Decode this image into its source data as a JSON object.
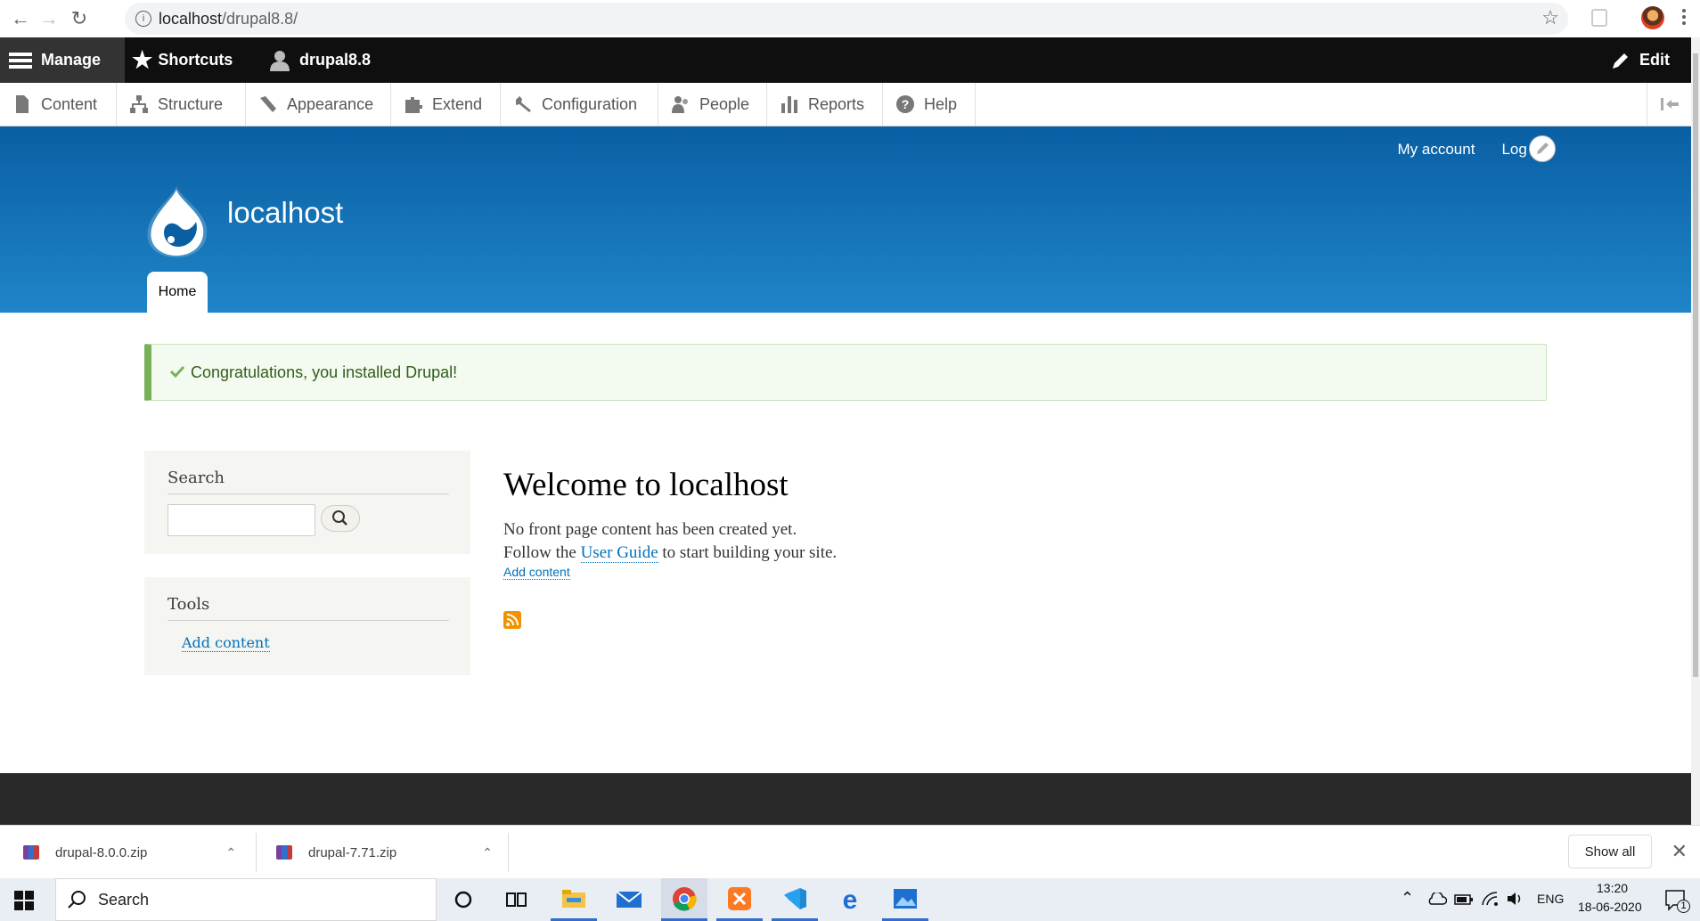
{
  "browser": {
    "url_host": "localhost",
    "url_path": "/drupal8.8/"
  },
  "toolbar": {
    "manage": "Manage",
    "shortcuts": "Shortcuts",
    "user": "drupal8.8",
    "edit": "Edit"
  },
  "tray": {
    "items": [
      {
        "label": "Content",
        "icon": "file-icon"
      },
      {
        "label": "Structure",
        "icon": "sitemap-icon"
      },
      {
        "label": "Appearance",
        "icon": "brush-icon"
      },
      {
        "label": "Extend",
        "icon": "puzzle-icon"
      },
      {
        "label": "Configuration",
        "icon": "wrench-icon"
      },
      {
        "label": "People",
        "icon": "people-icon"
      },
      {
        "label": "Reports",
        "icon": "bar-chart-icon"
      },
      {
        "label": "Help",
        "icon": "help-icon"
      }
    ]
  },
  "header": {
    "my_account": "My account",
    "log_out": "Log o",
    "site_name": "localhost",
    "home_tab": "Home"
  },
  "status": {
    "message": "Congratulations, you installed Drupal!",
    "color": "#77b259"
  },
  "sidebar": {
    "search_title": "Search",
    "tools_title": "Tools",
    "tools_link": "Add content"
  },
  "main": {
    "title": "Welcome to localhost",
    "line1": "No front page content has been created yet.",
    "line2_prefix": "Follow the ",
    "line2_link": "User Guide",
    "line2_suffix": " to start building your site.",
    "add_content": "Add content"
  },
  "downloads": {
    "file1": "drupal-8.0.0.zip",
    "file2": "drupal-7.71.zip",
    "show_all": "Show all"
  },
  "taskbar": {
    "search": "Search",
    "lang": "ENG",
    "time": "13:20",
    "date": "18-06-2020",
    "notification_count": "1"
  }
}
